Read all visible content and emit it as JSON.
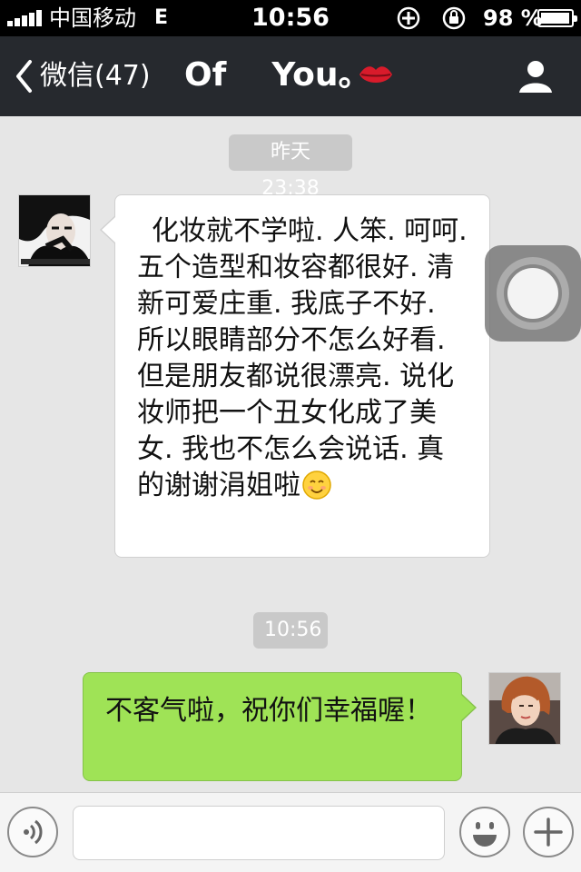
{
  "status_bar": {
    "carrier": "中国移动",
    "network": "E",
    "time": "10:56",
    "battery_percent": "98 %",
    "battery_level": 0.98,
    "icons": [
      "signal-icon",
      "orientation-lock-icon",
      "alarm-icon",
      "battery-icon"
    ]
  },
  "nav": {
    "back_label": "微信(47)",
    "title": "Of    You。",
    "icons": [
      "back-chevron-icon",
      "lips-icon",
      "profile-icon"
    ]
  },
  "messages": [
    {
      "direction": "incoming",
      "timestamp": "昨天 23:38",
      "text": "化妆就不学啦. 人笨. 呵呵.   五个造型和妆容都很好. 清新可爱庄重. 我底子不好. 所以眼睛部分不怎么好看. 但是朋友都说很漂亮. 说化妆师把一个丑女化成了美女. 我也不怎么会说话. 真的谢谢涓姐啦",
      "emoji": "smiley-icon"
    },
    {
      "direction": "outgoing",
      "timestamp": "10:56",
      "text": "不客气啦，祝你们幸福喔！"
    }
  ],
  "input_bar": {
    "placeholder": "",
    "icons": [
      "voice-icon",
      "emoji-icon",
      "plus-icon"
    ]
  },
  "colors": {
    "nav_background": "#26292e",
    "chat_background": "#e6e6e6",
    "outgoing_bubble": "#9fe356",
    "incoming_bubble": "#ffffff",
    "timestamp_pill": "#c9c9c9"
  }
}
